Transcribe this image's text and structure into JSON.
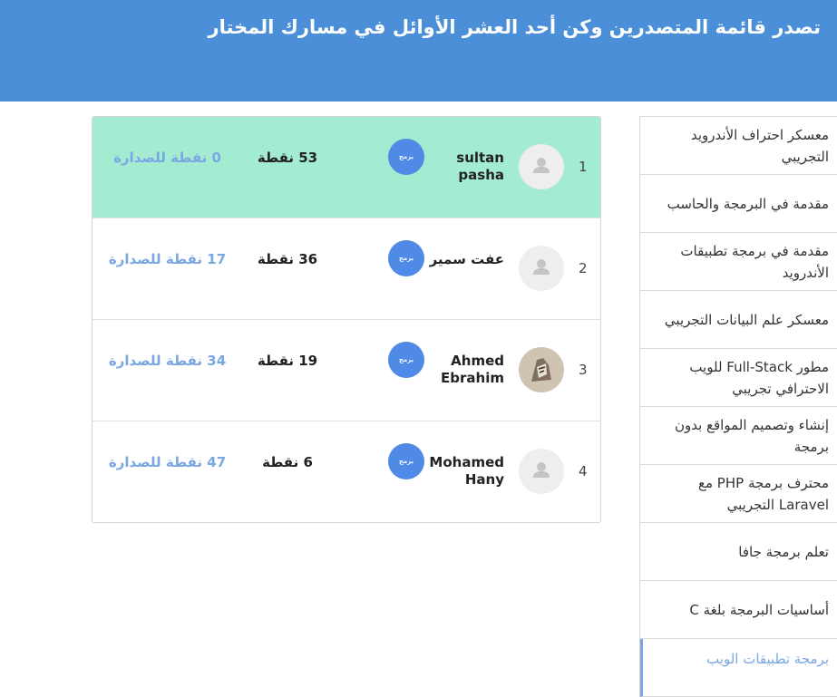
{
  "header": {
    "title": "تصدر قائمة المتصدرين وكن أحد العشر الأوائل في مسارك المختار"
  },
  "sidebar": {
    "items": [
      {
        "label": "معسكر احتراف الأندرويد التجريبي"
      },
      {
        "label": "مقدمة في البرمجة والحاسب"
      },
      {
        "label": "مقدمة في برمجة تطبيقات الأندرويد"
      },
      {
        "label": "معسكر علم البيانات التجريبي"
      },
      {
        "label": "مطور Full-Stack للويب الاحترافي تجريبي"
      },
      {
        "label": "إنشاء وتصميم المواقع بدون برمجة"
      },
      {
        "label": "محترف برمجة PHP مع Laravel التجريبي"
      },
      {
        "label": "تعلم برمجة جافا"
      },
      {
        "label": "أساسيات البرمجة بلغة C"
      },
      {
        "label": "برمجة تطبيقات الويب"
      }
    ],
    "active_index": 9
  },
  "leaderboard": {
    "badge_label": "برمج",
    "rows": [
      {
        "rank": "1",
        "name": "sultan pasha",
        "points": "53 نقطة",
        "to_top": "0 نقطة للصدارة",
        "avatar": "default-avatar-icon"
      },
      {
        "rank": "2",
        "name": "عفت سمير",
        "points": "36 نقطة",
        "to_top": "17 نقطة للصدارة",
        "avatar": "default-avatar-icon"
      },
      {
        "rank": "3",
        "name": "Ahmed Ebrahim",
        "points": "19 نقطة",
        "to_top": "34 نقطة للصدارة",
        "avatar": "user-photo"
      },
      {
        "rank": "4",
        "name": "Mohamed Hany",
        "points": "6 نقطة",
        "to_top": "47 نقطة للصدارة",
        "avatar": "default-avatar-icon"
      }
    ]
  },
  "colors": {
    "header_bg": "#4a8fd8",
    "highlight_row": "#a3ecd2",
    "accent": "#7aa7e4",
    "badge": "#4f8be6"
  }
}
